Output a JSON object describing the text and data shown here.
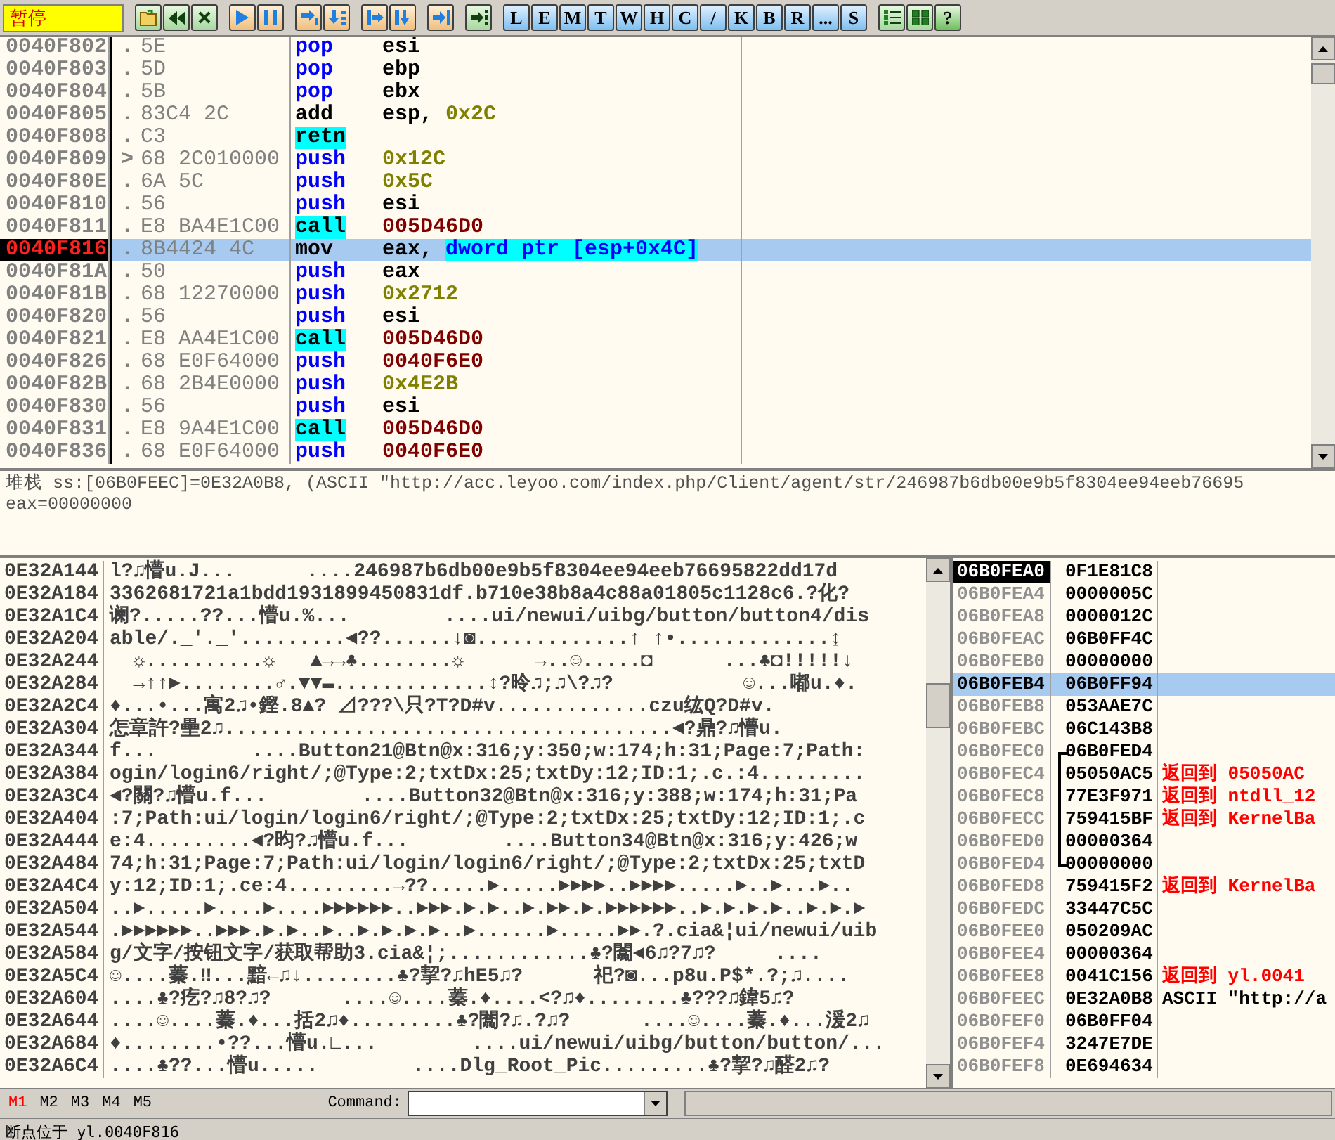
{
  "toolbar": {
    "status": "暂停",
    "letter_buttons": [
      "L",
      "E",
      "M",
      "T",
      "W",
      "H",
      "C",
      "/",
      "K",
      "B",
      "R",
      "...",
      "S"
    ],
    "help_button": "?"
  },
  "disassembly": {
    "rows": [
      {
        "address": "0040F802",
        "marker": ".",
        "bytes": "5E",
        "mnemonic": "pop",
        "kind": "stack",
        "operands": [
          {
            "text": "esi",
            "kind": "reg"
          }
        ],
        "current": false,
        "selected": false
      },
      {
        "address": "0040F803",
        "marker": ".",
        "bytes": "5D",
        "mnemonic": "pop",
        "kind": "stack",
        "operands": [
          {
            "text": "ebp",
            "kind": "reg"
          }
        ],
        "current": false,
        "selected": false
      },
      {
        "address": "0040F804",
        "marker": ".",
        "bytes": "5B",
        "mnemonic": "pop",
        "kind": "stack",
        "operands": [
          {
            "text": "ebx",
            "kind": "reg"
          }
        ],
        "current": false,
        "selected": false
      },
      {
        "address": "0040F805",
        "marker": ".",
        "bytes": "83C4 2C",
        "mnemonic": "add",
        "kind": "plain",
        "operands": [
          {
            "text": "esp,",
            "kind": "reg"
          },
          {
            "text": "0x2C",
            "kind": "imm"
          }
        ],
        "current": false,
        "selected": false
      },
      {
        "address": "0040F808",
        "marker": ".",
        "bytes": "C3",
        "mnemonic": "retn",
        "kind": "flow",
        "operands": [],
        "current": false,
        "selected": false
      },
      {
        "address": "0040F809",
        "marker": ">",
        "bytes": "68 2C010000",
        "mnemonic": "push",
        "kind": "stack",
        "operands": [
          {
            "text": "0x12C",
            "kind": "imm"
          }
        ],
        "current": false,
        "selected": false
      },
      {
        "address": "0040F80E",
        "marker": ".",
        "bytes": "6A 5C",
        "mnemonic": "push",
        "kind": "stack",
        "operands": [
          {
            "text": "0x5C",
            "kind": "imm"
          }
        ],
        "current": false,
        "selected": false
      },
      {
        "address": "0040F810",
        "marker": ".",
        "bytes": "56",
        "mnemonic": "push",
        "kind": "stack",
        "operands": [
          {
            "text": "esi",
            "kind": "reg"
          }
        ],
        "current": false,
        "selected": false
      },
      {
        "address": "0040F811",
        "marker": ".",
        "bytes": "E8 BA4E1C00",
        "mnemonic": "call",
        "kind": "flow",
        "operands": [
          {
            "text": "005D46D0",
            "kind": "addr"
          }
        ],
        "current": false,
        "selected": false
      },
      {
        "address": "0040F816",
        "marker": ".",
        "bytes": "8B4424 4C",
        "mnemonic": "mov",
        "kind": "plain",
        "operands": [
          {
            "text": "eax,",
            "kind": "reg"
          },
          {
            "text": "dword ptr [esp+0x4C]",
            "kind": "mem"
          }
        ],
        "current": true,
        "selected": true
      },
      {
        "address": "0040F81A",
        "marker": ".",
        "bytes": "50",
        "mnemonic": "push",
        "kind": "stack",
        "operands": [
          {
            "text": "eax",
            "kind": "reg"
          }
        ],
        "current": false,
        "selected": false
      },
      {
        "address": "0040F81B",
        "marker": ".",
        "bytes": "68 12270000",
        "mnemonic": "push",
        "kind": "stack",
        "operands": [
          {
            "text": "0x2712",
            "kind": "imm"
          }
        ],
        "current": false,
        "selected": false
      },
      {
        "address": "0040F820",
        "marker": ".",
        "bytes": "56",
        "mnemonic": "push",
        "kind": "stack",
        "operands": [
          {
            "text": "esi",
            "kind": "reg"
          }
        ],
        "current": false,
        "selected": false
      },
      {
        "address": "0040F821",
        "marker": ".",
        "bytes": "E8 AA4E1C00",
        "mnemonic": "call",
        "kind": "flow",
        "operands": [
          {
            "text": "005D46D0",
            "kind": "addr"
          }
        ],
        "current": false,
        "selected": false
      },
      {
        "address": "0040F826",
        "marker": ".",
        "bytes": "68 E0F64000",
        "mnemonic": "push",
        "kind": "stack",
        "operands": [
          {
            "text": "0040F6E0",
            "kind": "addr"
          }
        ],
        "current": false,
        "selected": false
      },
      {
        "address": "0040F82B",
        "marker": ".",
        "bytes": "68 2B4E0000",
        "mnemonic": "push",
        "kind": "stack",
        "operands": [
          {
            "text": "0x4E2B",
            "kind": "imm"
          }
        ],
        "current": false,
        "selected": false
      },
      {
        "address": "0040F830",
        "marker": ".",
        "bytes": "56",
        "mnemonic": "push",
        "kind": "stack",
        "operands": [
          {
            "text": "esi",
            "kind": "reg"
          }
        ],
        "current": false,
        "selected": false
      },
      {
        "address": "0040F831",
        "marker": ".",
        "bytes": "E8 9A4E1C00",
        "mnemonic": "call",
        "kind": "flow",
        "operands": [
          {
            "text": "005D46D0",
            "kind": "addr"
          }
        ],
        "current": false,
        "selected": false
      },
      {
        "address": "0040F836",
        "marker": ".",
        "bytes": "68 E0F64000",
        "mnemonic": "push",
        "kind": "stack",
        "operands": [
          {
            "text": "0040F6E0",
            "kind": "addr"
          }
        ],
        "current": false,
        "selected": false
      }
    ]
  },
  "info_pane": {
    "lines": [
      "堆栈 ss:[06B0FEEC]=0E32A0B8, (ASCII \"http://acc.leyoo.com/index.php/Client/agent/str/246987b6db00e9b5f8304ee94eeb76695",
      "eax=00000000"
    ]
  },
  "dump": {
    "rows": [
      {
        "address": "0E32A144",
        "text": "l?♫懵u.J...      ....246987b6db00e9b5f8304ee94eeb76695822dd17d"
      },
      {
        "address": "0E32A184",
        "text": "3362681721a1bdd1931899450831df.b710e38b8a4c88a01805c1128c6.?化?"
      },
      {
        "address": "0E32A1C4",
        "text": "谰?.....??...懵u.%...        ....ui/newui/uibg/button/button4/dis"
      },
      {
        "address": "0E32A204",
        "text": "able/._'._'.........◄??......↓◙.............↑ ↑•.............↨"
      },
      {
        "address": "0E32A244",
        "text": "  ☼..........☼   ▲→→♣........☼      →..☺.....◘      ...♣◘!!!!!↓"
      },
      {
        "address": "0E32A284",
        "text": "  →↑↑►........♂.▼▼▬.............↕?昤♫;♫\\?♫?           ☺...嘟u.♦."
      },
      {
        "address": "0E32A2C4",
        "text": "♦...•...寓2♫•鏗.8▲? ⊿???\\只?T?D#v.............czu纮Q?D#v."
      },
      {
        "address": "0E32A304",
        "text": "怎章許?壘2♫......................................◄?鼎?♫懵u."
      },
      {
        "address": "0E32A344",
        "text": "f...        ....Button21@Btn@x:316;y:350;w:174;h:31;Page:7;Path:"
      },
      {
        "address": "0E32A384",
        "text": "ogin/login6/right/;@Type:2;txtDx:25;txtDy:12;ID:1;.c.:4........."
      },
      {
        "address": "0E32A3C4",
        "text": "◄?關?♫懵u.f...        ....Button32@Btn@x:316;y:388;w:174;h:31;Pa"
      },
      {
        "address": "0E32A404",
        "text": ":7;Path:ui/login/login6/right/;@Type:2;txtDx:25;txtDy:12;ID:1;.c"
      },
      {
        "address": "0E32A444",
        "text": "e:4.........◄?昀?♫懵u.f...        ....Button34@Btn@x:316;y:426;w"
      },
      {
        "address": "0E32A484",
        "text": "74;h:31;Page:7;Path:ui/login/login6/right/;@Type:2;txtDx:25;txtD"
      },
      {
        "address": "0E32A4C4",
        "text": "y:12;ID:1;.ce:4.........→??.....►.....►►►►..►►►►.....►..►...►.."
      },
      {
        "address": "0E32A504",
        "text": "..►.....►....►....►►►►►►..►►►.►.►..►.►►.►.►►►►►►..►.►.►.►..►.►.►"
      },
      {
        "address": "0E32A544",
        "text": ".►►►►►►..►►►.►.►..►..►.►.►.►..►......►.....►►.?.cia&¦ui/newui/uib"
      },
      {
        "address": "0E32A584",
        "text": "g/文字/按钮文字/获取帮助3.cia&¦;............♣?闟◄6♫?7♫?     ...."
      },
      {
        "address": "0E32A5C4",
        "text": "☺....蓁.‼...黯←♫↓........♣?挈?♫hE5♫?      祀?◙...p8u.P$*.?;♫...."
      },
      {
        "address": "0E32A604",
        "text": "....♣?疙?♫8?♫?      ....☺....蓁.♦....<?♫♦........♣???♫鍏5♫?"
      },
      {
        "address": "0E32A644",
        "text": "....☺....蓁.♦...括2♫♦.........♣?闟?♫.?♫?      ....☺....蓁.♦...湲2♫"
      },
      {
        "address": "0E32A684",
        "text": "♦........•??...懵u.∟...        ....ui/newui/uibg/button/button/..."
      },
      {
        "address": "0E32A6C4",
        "text": "....♣??...懵u.....        ....Dlg_Root_Pic.........♣?挈?♫醛2♫?"
      }
    ]
  },
  "stack": {
    "rows": [
      {
        "address": "06B0FEA0",
        "value": "0F1E81C8",
        "in_frame": false,
        "current": true,
        "selected": false
      },
      {
        "address": "06B0FEA4",
        "value": "0000005C",
        "in_frame": false,
        "current": false,
        "selected": false
      },
      {
        "address": "06B0FEA8",
        "value": "0000012C",
        "in_frame": false,
        "current": false,
        "selected": false
      },
      {
        "address": "06B0FEAC",
        "value": "06B0FF4C",
        "in_frame": false,
        "current": false,
        "selected": false
      },
      {
        "address": "06B0FEB0",
        "value": "00000000",
        "in_frame": false,
        "current": false,
        "selected": false
      },
      {
        "address": "06B0FEB4",
        "value": "06B0FF94",
        "in_frame": false,
        "current": false,
        "selected": true
      },
      {
        "address": "06B0FEB8",
        "value": "053AAE7C",
        "in_frame": false,
        "current": false,
        "selected": false
      },
      {
        "address": "06B0FEBC",
        "value": "06C143B8",
        "in_frame": false,
        "current": false,
        "selected": false
      },
      {
        "address": "06B0FEC0",
        "value": "06B0FED4",
        "in_frame": true,
        "current": false,
        "selected": false
      },
      {
        "address": "06B0FEC4",
        "value": "05050AC5",
        "comment": {
          "text": "返回到 05050AC",
          "kind": "return"
        },
        "in_frame": true,
        "current": false,
        "selected": false
      },
      {
        "address": "06B0FEC8",
        "value": "77E3F971",
        "comment": {
          "text": "返回到 ntdll_12",
          "kind": "return"
        },
        "in_frame": true,
        "current": false,
        "selected": false
      },
      {
        "address": "06B0FECC",
        "value": "759415BF",
        "comment": {
          "text": "返回到 KernelBa",
          "kind": "return"
        },
        "in_frame": true,
        "current": false,
        "selected": false
      },
      {
        "address": "06B0FED0",
        "value": "00000364",
        "in_frame": true,
        "current": false,
        "selected": false
      },
      {
        "address": "06B0FED4",
        "value": "00000000",
        "in_frame": true,
        "current": false,
        "selected": false
      },
      {
        "address": "06B0FED8",
        "value": "759415F2",
        "comment": {
          "text": "返回到 KernelBa",
          "kind": "return"
        },
        "in_frame": false,
        "current": false,
        "selected": false
      },
      {
        "address": "06B0FEDC",
        "value": "33447C5C",
        "in_frame": false,
        "current": false,
        "selected": false
      },
      {
        "address": "06B0FEE0",
        "value": "050209AC",
        "in_frame": false,
        "current": false,
        "selected": false
      },
      {
        "address": "06B0FEE4",
        "value": "00000364",
        "in_frame": false,
        "current": false,
        "selected": false
      },
      {
        "address": "06B0FEE8",
        "value": "0041C156",
        "comment": {
          "text": "返回到 yl.0041",
          "kind": "return"
        },
        "in_frame": false,
        "current": false,
        "selected": false
      },
      {
        "address": "06B0FEEC",
        "value": "0E32A0B8",
        "comment": {
          "text": "ASCII \"http://a",
          "kind": "ascii"
        },
        "in_frame": false,
        "current": false,
        "selected": false
      },
      {
        "address": "06B0FEF0",
        "value": "06B0FF04",
        "in_frame": false,
        "current": false,
        "selected": false
      },
      {
        "address": "06B0FEF4",
        "value": "3247E7DE",
        "in_frame": false,
        "current": false,
        "selected": false
      },
      {
        "address": "06B0FEF8",
        "value": "0E694634",
        "in_frame": false,
        "current": false,
        "selected": false
      }
    ]
  },
  "bottom_bar": {
    "memory_tabs": [
      {
        "label": "M1",
        "selected": true
      },
      {
        "label": "M2",
        "selected": false
      },
      {
        "label": "M3",
        "selected": false
      },
      {
        "label": "M4",
        "selected": false
      },
      {
        "label": "M5",
        "selected": false
      }
    ],
    "command_label": "Command:"
  },
  "status_bar": {
    "text": "断点位于 yl.0040F816"
  }
}
